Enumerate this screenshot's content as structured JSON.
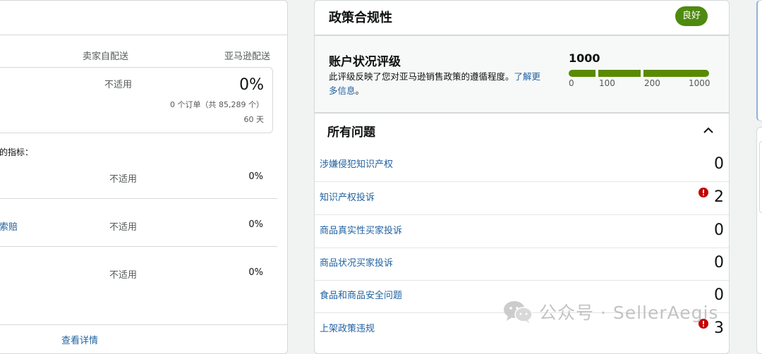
{
  "left_card": {
    "col_seller": "卖家自配送",
    "col_amazon": "亚马逊配送",
    "metric": {
      "seller_value": "不适用",
      "amazon_value": "0%",
      "orders": "0 个订单（共 85,289 个）",
      "days": "60 天"
    },
    "sub_heading": "的指标：",
    "rows": [
      {
        "name": "",
        "seller": "不适用",
        "amazon": "0%"
      },
      {
        "name": "索赔",
        "seller": "不适用",
        "amazon": "0%"
      },
      {
        "name": "",
        "seller": "不适用",
        "amazon": "0%"
      }
    ],
    "view_details": "查看详情"
  },
  "policy_card": {
    "title": "政策合规性",
    "badge": "良好",
    "badge_color": "#4f8a10",
    "rating": {
      "title": "账户状况评级",
      "description": "此评级反映了您对亚马逊销售政策的遵循程度。",
      "link": "了解更多信息",
      "description_end": "。",
      "score": "1000",
      "ticks": [
        "0",
        "100",
        "200",
        "1000"
      ],
      "bar_color": "#5a8a00"
    },
    "issues_title": "所有问题",
    "issues": [
      {
        "name": "涉嫌侵犯知识产权",
        "count": "0",
        "alert": false
      },
      {
        "name": "知识产权投诉",
        "count": "2",
        "alert": true
      },
      {
        "name": "商品真实性买家投诉",
        "count": "0",
        "alert": false
      },
      {
        "name": "商品状况买家投诉",
        "count": "0",
        "alert": false
      },
      {
        "name": "食品和商品安全问题",
        "count": "0",
        "alert": false
      },
      {
        "name": "上架政策违规",
        "count": "3",
        "alert": true
      }
    ]
  },
  "watermark": {
    "text": "公众号 · SellerAegis",
    "icon": "wechat-icon"
  }
}
